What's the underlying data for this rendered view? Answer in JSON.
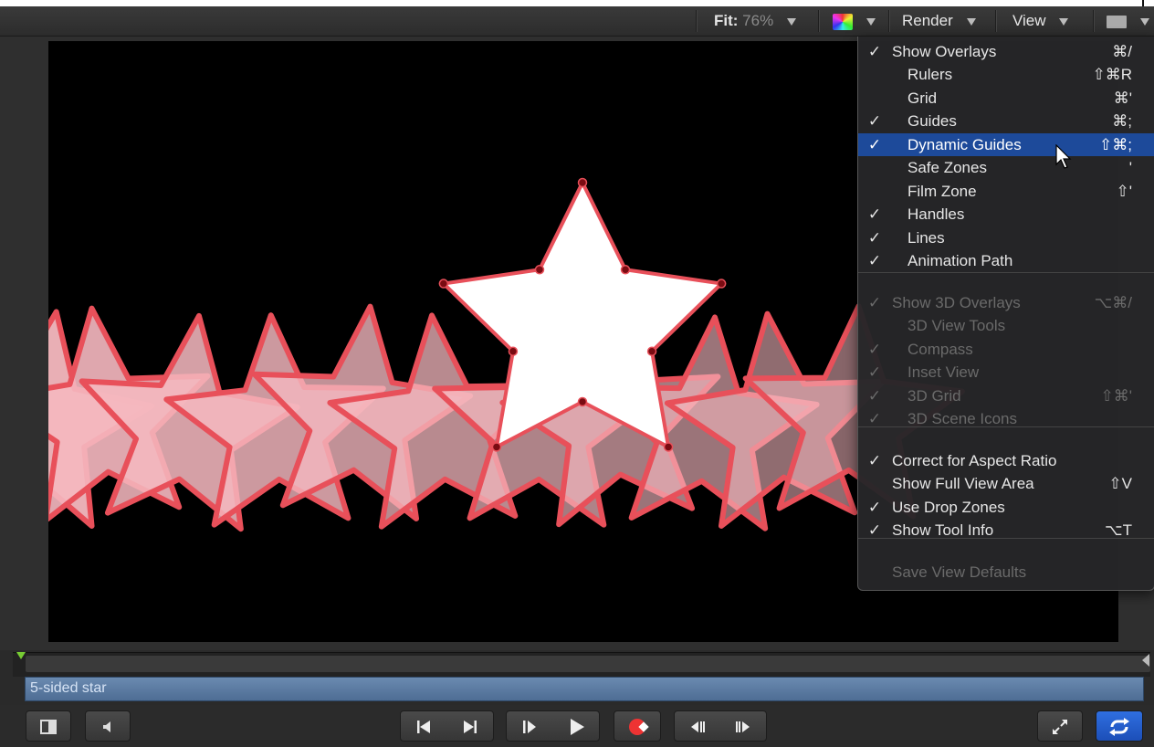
{
  "toolbar": {
    "fit_label": "Fit:",
    "fit_value": "76%",
    "color_icon": "channels-color-icon",
    "render_label": "Render",
    "view_label": "View",
    "layout_icon": "screen-layout-icon"
  },
  "view_menu": {
    "items": [
      {
        "check": "✓",
        "label": "Show Overlays",
        "shortcut": "⌘/",
        "indent": false,
        "disabled": false
      },
      {
        "check": "",
        "label": "Rulers",
        "shortcut": "⇧⌘R",
        "indent": true,
        "disabled": false
      },
      {
        "check": "",
        "label": "Grid",
        "shortcut": "⌘'",
        "indent": true,
        "disabled": false
      },
      {
        "check": "✓",
        "label": "Guides",
        "shortcut": "⌘;",
        "indent": true,
        "disabled": false
      },
      {
        "check": "✓",
        "label": "Dynamic Guides",
        "shortcut": "⇧⌘;",
        "indent": true,
        "disabled": false,
        "highlighted": true
      },
      {
        "check": "",
        "label": "Safe Zones",
        "shortcut": "'",
        "indent": true,
        "disabled": false
      },
      {
        "check": "",
        "label": "Film Zone",
        "shortcut": "⇧'",
        "indent": true,
        "disabled": false
      },
      {
        "check": "✓",
        "label": "Handles",
        "shortcut": "",
        "indent": true,
        "disabled": false
      },
      {
        "check": "✓",
        "label": "Lines",
        "shortcut": "",
        "indent": true,
        "disabled": false
      },
      {
        "check": "✓",
        "label": "Animation Path",
        "shortcut": "",
        "indent": true,
        "disabled": false
      },
      {
        "check": "✓",
        "label": "Show 3D Overlays",
        "shortcut": "⌥⌘/",
        "indent": false,
        "disabled": true
      },
      {
        "check": "",
        "label": "3D View Tools",
        "shortcut": "",
        "indent": true,
        "disabled": true
      },
      {
        "check": "✓",
        "label": "Compass",
        "shortcut": "",
        "indent": true,
        "disabled": true
      },
      {
        "check": "✓",
        "label": "Inset View",
        "shortcut": "",
        "indent": true,
        "disabled": true
      },
      {
        "check": "✓",
        "label": "3D Grid",
        "shortcut": "⇧⌘'",
        "indent": true,
        "disabled": true
      },
      {
        "check": "✓",
        "label": "3D Scene Icons",
        "shortcut": "",
        "indent": true,
        "disabled": true
      },
      {
        "check": "✓",
        "label": "Correct for Aspect Ratio",
        "shortcut": "",
        "indent": false,
        "disabled": false
      },
      {
        "check": "",
        "label": "Show Full View Area",
        "shortcut": "⇧V",
        "indent": false,
        "disabled": false
      },
      {
        "check": "✓",
        "label": "Use Drop Zones",
        "shortcut": "",
        "indent": false,
        "disabled": false
      },
      {
        "check": "✓",
        "label": "Show Tool Info",
        "shortcut": "⌥T",
        "indent": false,
        "disabled": false
      },
      {
        "check": "",
        "label": "Save View Defaults",
        "shortcut": "",
        "indent": false,
        "disabled": true
      }
    ]
  },
  "timeline": {
    "clip_name": "5-sided star"
  },
  "transport": {
    "toggle_panel_icon": "panel-toggle-icon",
    "mute_icon": "speaker-icon",
    "go_start_icon": "go-to-start-icon",
    "go_end_icon": "go-to-end-icon",
    "play_from_start_icon": "play-from-start-icon",
    "play_icon": "play-icon",
    "record_icon": "record-icon",
    "prev_frame_icon": "previous-frame-icon",
    "next_frame_icon": "next-frame-icon",
    "fullscreen_icon": "fullscreen-icon",
    "loop_icon": "loop-icon"
  },
  "colors": {
    "menu_highlight": "#1d4a9a",
    "star_fill": "#ffffff",
    "star_stroke": "#e8505a",
    "ghost_fill": "#f5b8bf",
    "clip_bar": "#5a7ba3",
    "loop_active": "#2f6fe0"
  }
}
